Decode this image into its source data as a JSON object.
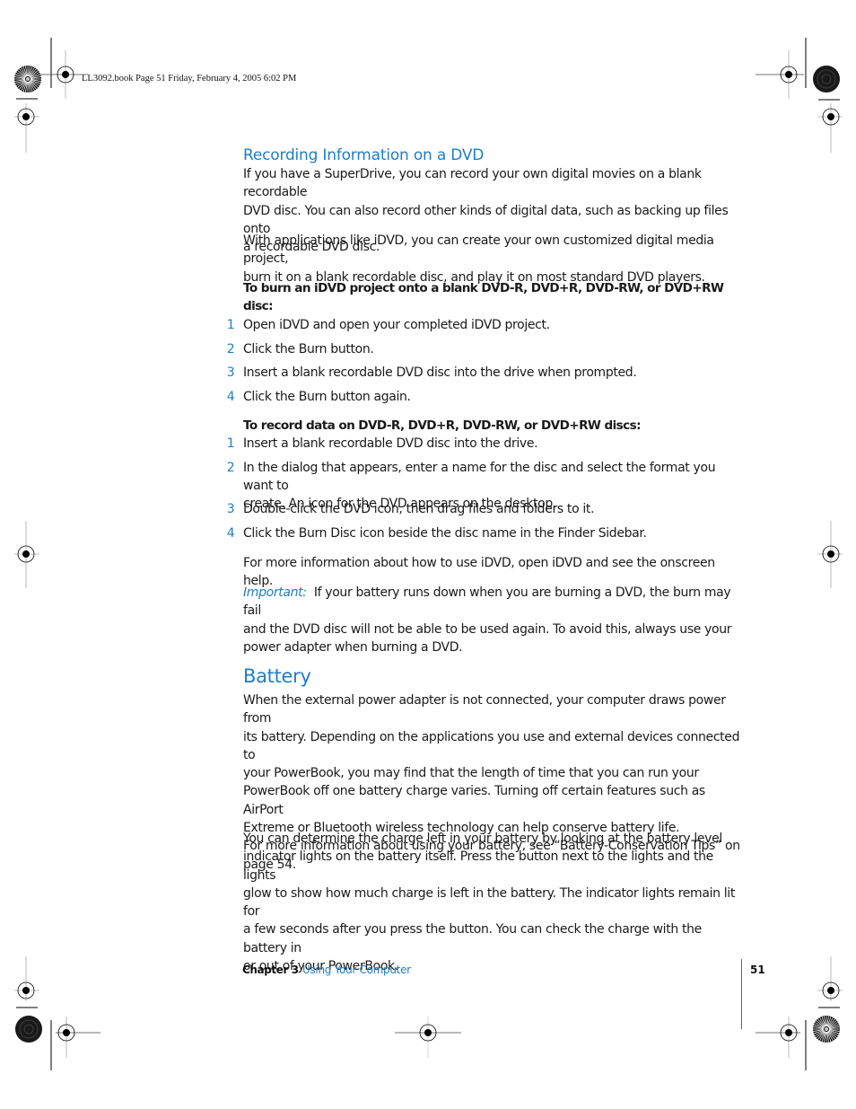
{
  "slug": "LL3092.book  Page 51  Friday, February 4, 2005  6:02 PM",
  "section_dvd": {
    "heading": "Recording Information on a DVD",
    "intro_lines": [
      "If you have a SuperDrive, you can record your own digital movies on a blank recordable",
      "DVD disc. You can also record other kinds of digital data, such as backing up files onto",
      "a recordable DVD disc."
    ],
    "para2_lines": [
      "With applications like iDVD, you can create your own customized digital media project,",
      "burn it on a blank recordable disc, and play it on most standard DVD players."
    ],
    "task1": {
      "title_lines": [
        "To burn an iDVD project onto a blank DVD-R, DVD+R, DVD-RW, or DVD+RW",
        "disc:"
      ],
      "steps": [
        {
          "num": "1",
          "lines": [
            "Open iDVD and open your completed iDVD project."
          ]
        },
        {
          "num": "2",
          "lines": [
            "Click the Burn button."
          ]
        },
        {
          "num": "3",
          "lines": [
            "Insert a blank recordable DVD disc into the drive when prompted."
          ]
        },
        {
          "num": "4",
          "lines": [
            "Click the Burn button again."
          ]
        }
      ]
    },
    "task2": {
      "title": "To record data on DVD-R, DVD+R, DVD-RW, or DVD+RW discs:",
      "steps": [
        {
          "num": "1",
          "lines": [
            "Insert a blank recordable DVD disc into the drive."
          ]
        },
        {
          "num": "2",
          "lines": [
            "In the dialog that appears, enter a name for the disc and select the format you want to",
            "create. An icon for the DVD appears on the desktop."
          ]
        },
        {
          "num": "3",
          "lines": [
            "Double-click the DVD icon, then drag files and folders to it."
          ]
        },
        {
          "num": "4",
          "lines": [
            "Click the Burn Disc icon beside the disc name in the Finder Sidebar."
          ]
        }
      ]
    },
    "more_info": "For more information about how to use iDVD, open iDVD and see the onscreen help.",
    "important": {
      "label": "Important:",
      "lines": [
        "If your battery runs down when you are burning a DVD, the burn may fail",
        "and the DVD disc will not be able to be used again. To avoid this, always use your",
        "power adapter when burning a DVD."
      ]
    }
  },
  "section_battery": {
    "heading": "Battery",
    "para1_lines": [
      "When the external power adapter is not connected, your computer draws power from",
      "its battery. Depending on the applications you use and external devices connected to",
      "your PowerBook, you may find that the length of time that you can run your",
      "PowerBook off one battery charge varies. Turning off certain features such as AirPort",
      "Extreme or Bluetooth wireless technology can help conserve battery life.",
      "For more information about using your battery, see “Battery-Conservation Tips” on",
      "page 54."
    ],
    "para2_lines": [
      "You can determine the charge left in your battery by looking at the battery level",
      "indicator lights on the battery itself. Press the button next to the lights and the lights",
      "glow to show how much charge is left in the battery. The indicator lights remain lit for",
      "a few seconds after you press the button. You can check the charge with the battery in",
      "or out of your PowerBook."
    ]
  },
  "footer": {
    "chapter": "Chapter 3",
    "chapter_title": "Using Your Computer",
    "page_number": "51"
  },
  "colors": {
    "accent": "#1f7dc6",
    "text": "#1a1a1a"
  }
}
